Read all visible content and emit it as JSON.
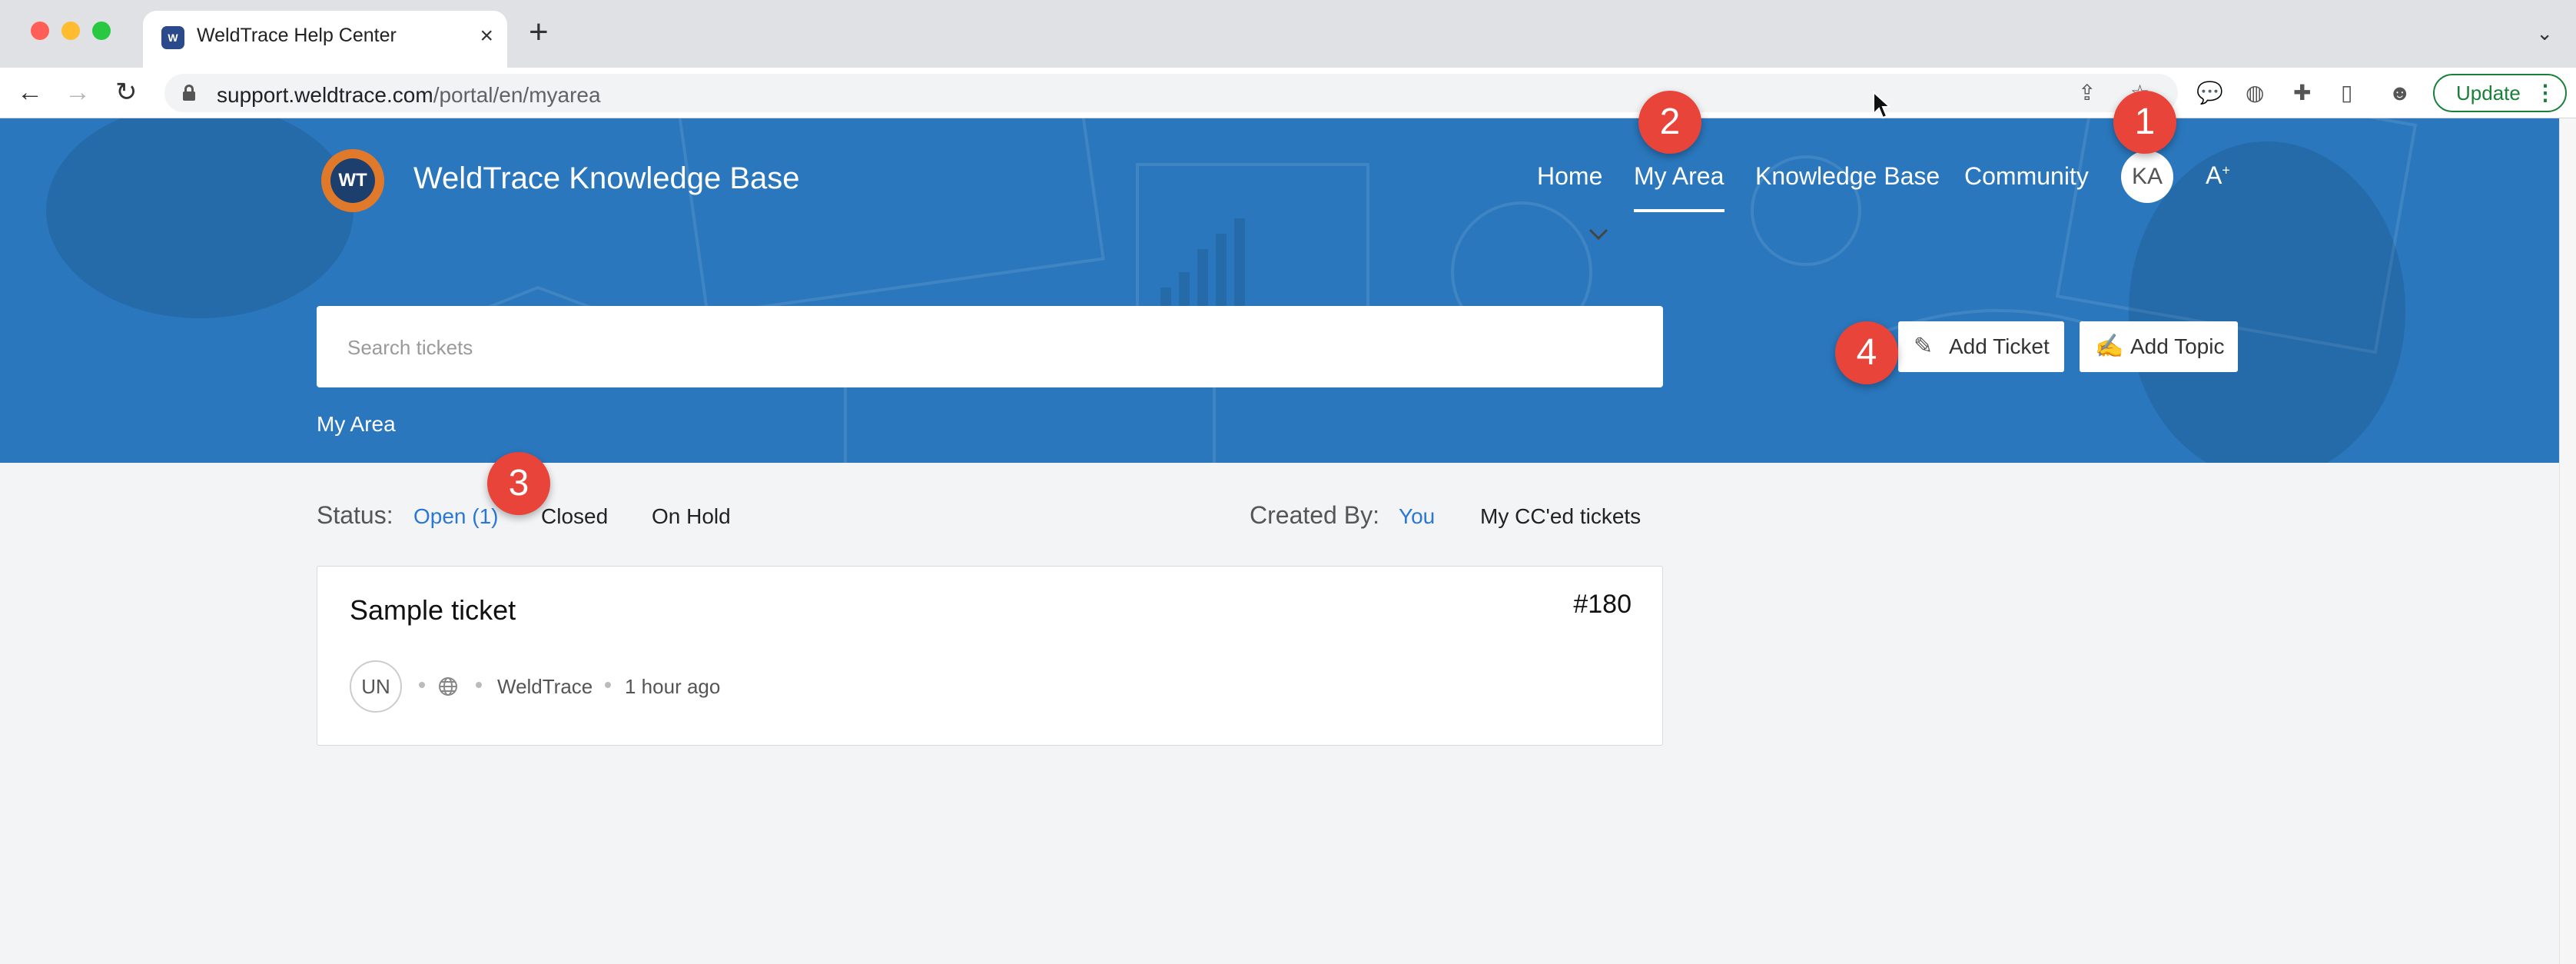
{
  "browser": {
    "tab_title": "WeldTrace Help Center",
    "url_host": "support.weldtrace.com",
    "url_path": "/portal/en/myarea",
    "update_label": "Update",
    "icons": [
      "back-arrow-icon",
      "forward-arrow-icon",
      "reload-icon",
      "lock-icon",
      "share-icon",
      "star-icon",
      "chat-icon",
      "extension-icon",
      "puzzle-icon",
      "sidebar-icon",
      "profile-icon"
    ]
  },
  "header": {
    "site_title": "WeldTrace Knowledge Base",
    "nav": {
      "home": "Home",
      "my_area": "My Area",
      "knowledge_base": "Knowledge Base",
      "community": "Community"
    },
    "avatar": "KA",
    "accessibility": "A"
  },
  "search": {
    "placeholder": "Search tickets"
  },
  "breadcrumb": "My Area",
  "actions": {
    "add_ticket": "Add Ticket",
    "add_topic": "Add Topic"
  },
  "filters": {
    "status_label": "Status:",
    "open": "Open (1)",
    "closed": "Closed",
    "on_hold": "On Hold",
    "created_by_label": "Created By:",
    "you": "You",
    "cced": "My CC'ed tickets"
  },
  "ticket": {
    "title": "Sample ticket",
    "id": "#180",
    "avatar": "UN",
    "department": "WeldTrace",
    "time": "1 hour ago"
  },
  "badges": {
    "one": "1",
    "two": "2",
    "three": "3",
    "four": "4"
  },
  "colors": {
    "hero": "#2a77bd",
    "badge": "#e9443a",
    "active_link": "#2a77d4"
  }
}
